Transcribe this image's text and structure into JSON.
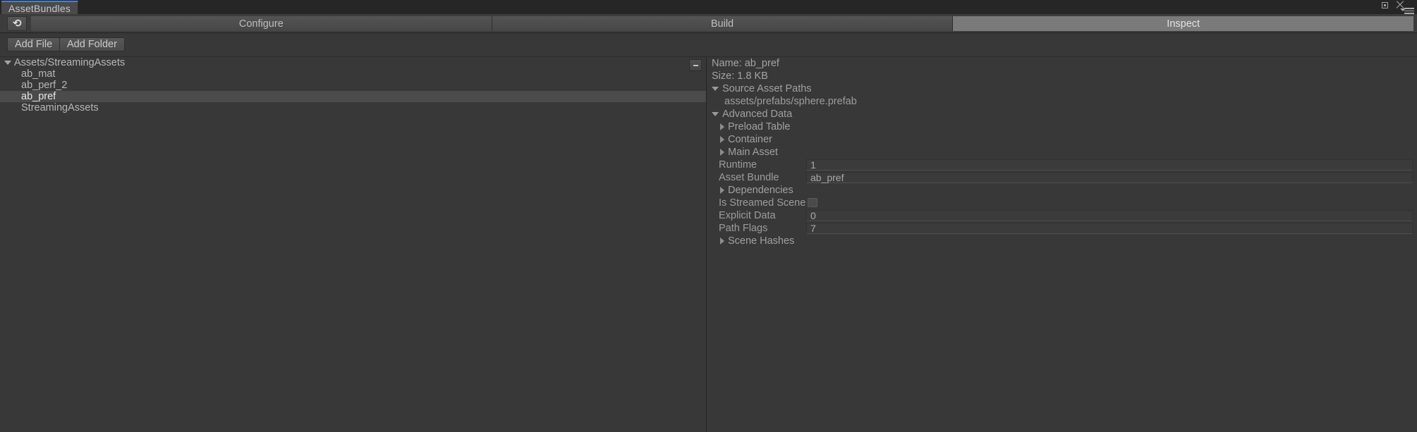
{
  "window": {
    "tab_title": "AssetBundles",
    "controls": {
      "maximize": "maximize-icon",
      "close": "close-icon",
      "menu": "window-menu-icon"
    }
  },
  "toolbar": {
    "refresh_glyph": "⟳",
    "refresh_name": "refresh-icon",
    "tabs": [
      {
        "label": "Configure",
        "selected": false
      },
      {
        "label": "Build",
        "selected": false
      },
      {
        "label": "Inspect",
        "selected": true
      }
    ]
  },
  "actions": {
    "add_file": "Add File",
    "add_folder": "Add Folder"
  },
  "tree": {
    "corner_button": "options-button",
    "root": {
      "label": "Assets/StreamingAssets",
      "expanded": true
    },
    "children": [
      {
        "label": "ab_mat",
        "selected": false
      },
      {
        "label": "ab_perf_2",
        "selected": false
      },
      {
        "label": "ab_pref",
        "selected": true
      },
      {
        "label": "StreamingAssets",
        "selected": false
      }
    ]
  },
  "inspector": {
    "name_line": "Name: ab_pref",
    "size_line": "Size: 1.8 KB",
    "source_asset_paths": {
      "label": "Source Asset Paths",
      "expanded": true,
      "paths": [
        "assets/prefabs/sphere.prefab"
      ]
    },
    "advanced_data": {
      "label": "Advanced Data",
      "expanded": true,
      "foldouts_top": [
        {
          "label": "Preload Table",
          "expanded": false
        },
        {
          "label": "Container",
          "expanded": false
        },
        {
          "label": "Main Asset",
          "expanded": false
        }
      ],
      "fields_top": [
        {
          "label": "Runtime Compatibility",
          "value": "1"
        },
        {
          "label": "Asset Bundle Name",
          "value": "ab_pref"
        }
      ],
      "dependencies": {
        "label": "Dependencies",
        "expanded": false
      },
      "is_streamed_scene": {
        "label": "Is Streamed Scene Ass",
        "checked": false
      },
      "fields_bottom": [
        {
          "label": "Explicit Data Layout",
          "value": "0"
        },
        {
          "label": "Path Flags",
          "value": "7"
        }
      ],
      "scene_hashes": {
        "label": "Scene Hashes",
        "expanded": false
      }
    }
  }
}
